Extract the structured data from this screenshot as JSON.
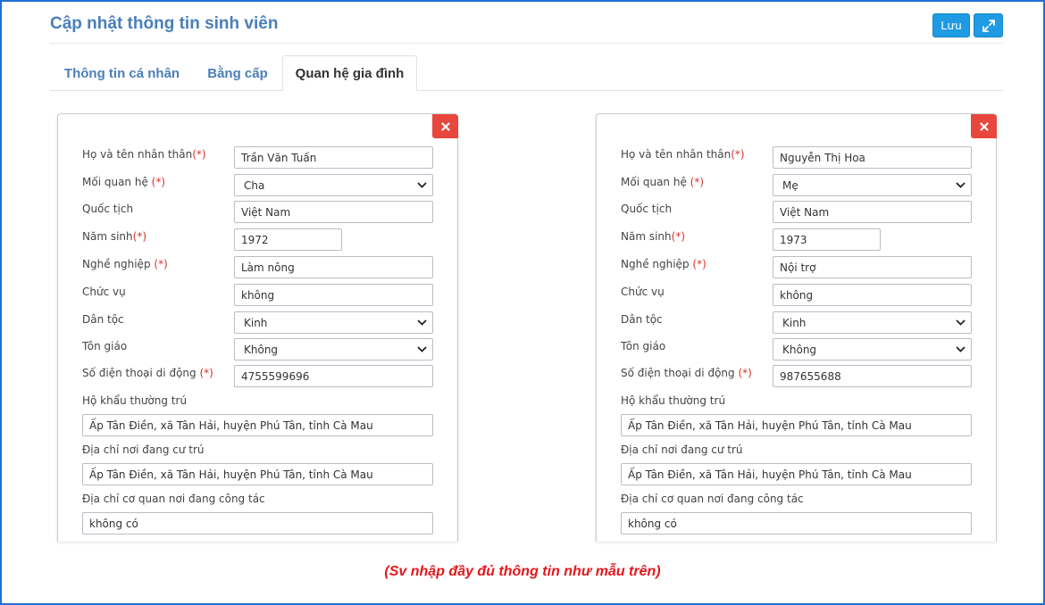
{
  "header": {
    "title": "Cập nhật thông tin sinh viên",
    "save_label": "Lưu"
  },
  "tabs": [
    {
      "label": "Thông tin cá nhân"
    },
    {
      "label": "Bằng cấp"
    },
    {
      "label": "Quan hệ gia đình"
    }
  ],
  "labels": {
    "full_name": "Họ và tên nhân thân",
    "relation": "Mối quan hệ",
    "nationality": "Quốc tịch",
    "birth_year": "Năm sinh",
    "occupation": "Nghề nghiệp",
    "position": "Chức vụ",
    "ethnicity": "Dân tộc",
    "religion": "Tôn giáo",
    "phone": "Số điện thoại di động",
    "permanent_address": "Hộ khẩu thường trú",
    "current_address": "Địa chỉ nơi đang cư trú",
    "work_address": "Địa chỉ cơ quan nơi đang công tác",
    "required_mark": "(*)"
  },
  "members": [
    {
      "full_name": "Trần Văn Tuấn",
      "relation": "Cha",
      "nationality": "Việt Nam",
      "birth_year": "1972",
      "occupation": "Làm nông",
      "position": "không",
      "ethnicity": "Kinh",
      "religion": "Không",
      "phone": "4755599696",
      "permanent_address": "Ấp Tân Điền, xã Tân Hải, huyện Phú Tân, tỉnh Cà Mau",
      "current_address": "Ấp Tân Điền, xã Tân Hải, huyện Phú Tân, tỉnh Cà Mau",
      "work_address": "không có"
    },
    {
      "full_name": "Nguyễn Thị Hoa",
      "relation": "Mẹ",
      "nationality": "Việt Nam",
      "birth_year": "1973",
      "occupation": "Nội trợ",
      "position": "không",
      "ethnicity": "Kinh",
      "religion": "Không",
      "phone": "987655688",
      "permanent_address": "Ấp Tân Điền, xã Tân Hải, huyện Phú Tân, tỉnh Cà Mau",
      "current_address": "Ấp Tân Điền, xã Tân Hải, huyện Phú Tân, tỉnh Cà Mau",
      "work_address": "không có"
    }
  ],
  "footer_note": "(Sv nhập đầy đủ thông tin như mẫu trên)",
  "colors": {
    "primary": "#1e9be3",
    "danger": "#e8473e",
    "title": "#4a7fb8",
    "note": "#e4161b"
  },
  "icons": {
    "expand": "expand-icon",
    "remove": "close-icon",
    "dropdown": "chevron-down-icon"
  }
}
